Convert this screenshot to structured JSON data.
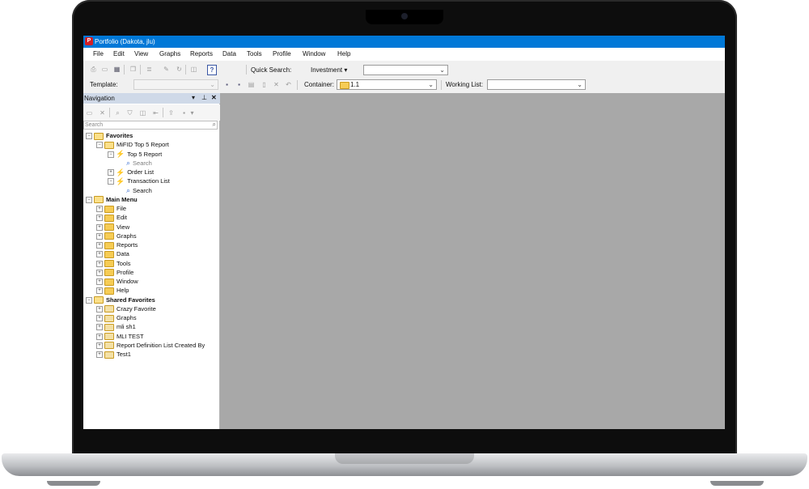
{
  "window": {
    "title": "Portfolio (Dakota, jlu)"
  },
  "menu": [
    "File",
    "Edit",
    "View",
    "Graphs",
    "Reports",
    "Data",
    "Tools",
    "Profile",
    "Window",
    "Help"
  ],
  "toolbar": {
    "quick_search_label": "Quick Search:",
    "investment_label": "Investment",
    "template_label": "Template:",
    "container_label": "Container:",
    "container_value": "1.1",
    "working_list_label": "Working List:"
  },
  "nav": {
    "title": "Navigation",
    "search_placeholder": "Search",
    "tree": [
      {
        "label": "Favorites",
        "bold": true,
        "level": 0,
        "icon": "folder-open",
        "expander": "−"
      },
      {
        "label": "MiFID Top 5 Report",
        "level": 1,
        "icon": "folder-open",
        "expander": "−"
      },
      {
        "label": "Top 5 Report",
        "level": 2,
        "icon": "bolt",
        "expander": "−"
      },
      {
        "label": "Search",
        "level": 3,
        "icon": "magnifier",
        "muted": true
      },
      {
        "label": "Order List",
        "level": 2,
        "icon": "bolt",
        "expander": "+"
      },
      {
        "label": "Transaction List",
        "level": 2,
        "icon": "bolt",
        "expander": "−"
      },
      {
        "label": "Search",
        "level": 3,
        "icon": "magnifier"
      },
      {
        "label": "Main Menu",
        "bold": true,
        "level": 0,
        "icon": "folder-open",
        "expander": "−"
      },
      {
        "label": "File",
        "level": 1,
        "icon": "folder",
        "expander": "+"
      },
      {
        "label": "Edit",
        "level": 1,
        "icon": "folder",
        "expander": "+"
      },
      {
        "label": "View",
        "level": 1,
        "icon": "folder",
        "expander": "+"
      },
      {
        "label": "Graphs",
        "level": 1,
        "icon": "folder",
        "expander": "+"
      },
      {
        "label": "Reports",
        "level": 1,
        "icon": "folder",
        "expander": "+"
      },
      {
        "label": "Data",
        "level": 1,
        "icon": "folder",
        "expander": "+"
      },
      {
        "label": "Tools",
        "level": 1,
        "icon": "folder",
        "expander": "+"
      },
      {
        "label": "Profile",
        "level": 1,
        "icon": "folder",
        "expander": "+"
      },
      {
        "label": "Window",
        "level": 1,
        "icon": "folder",
        "expander": "+"
      },
      {
        "label": "Help",
        "level": 1,
        "icon": "folder",
        "expander": "+"
      },
      {
        "label": "Shared Favorites",
        "bold": true,
        "level": 0,
        "icon": "folder-open",
        "expander": "−"
      },
      {
        "label": "Crazy Favorite",
        "level": 1,
        "icon": "shared-folder",
        "expander": "+"
      },
      {
        "label": "Graphs",
        "level": 1,
        "icon": "shared-folder",
        "expander": "+"
      },
      {
        "label": "mli sh1",
        "level": 1,
        "icon": "shared-folder",
        "expander": "+"
      },
      {
        "label": "MLI TEST",
        "level": 1,
        "icon": "shared-folder",
        "expander": "+"
      },
      {
        "label": "Report Definition List Created By",
        "level": 1,
        "icon": "shared-folder",
        "expander": "+"
      },
      {
        "label": "Test1",
        "level": 1,
        "icon": "shared-folder",
        "expander": "+"
      }
    ]
  },
  "colors": {
    "titlebar": "#0078d7",
    "workspace": "#a8a8a8",
    "nav_header": "#cfd9e8"
  }
}
